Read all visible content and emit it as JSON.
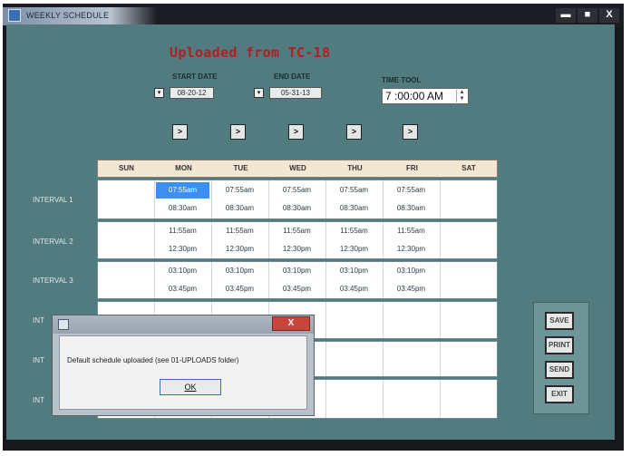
{
  "window": {
    "title": "WEEKLY SCHEDULE",
    "controls": {
      "minimize": "▬",
      "maximize": "■",
      "close": "X"
    }
  },
  "header": {
    "headline": "Uploaded from TC-18",
    "start_date_label": "START DATE",
    "start_date_value": "08-20-12",
    "end_date_label": "END DATE",
    "end_date_value": "05-31-13",
    "time_label": "TIME TOOL",
    "time_value": "7 :00:00 AM",
    "dropdown_glyph": "▾",
    "nav_glyph": ">"
  },
  "grid": {
    "days": [
      "SUN",
      "MON",
      "TUE",
      "WED",
      "THU",
      "FRI",
      "SAT"
    ],
    "interval_labels": [
      "INTERVAL 1",
      "INTERVAL 2",
      "INTERVAL 3"
    ],
    "hidden_row_label": "INT",
    "intervals": [
      {
        "start": [
          "",
          "07:55am",
          "07:55am",
          "07:55am",
          "07:55am",
          "07:55am",
          ""
        ],
        "end": [
          "",
          "08:30am",
          "08:30am",
          "08:30am",
          "08:30am",
          "08:30am",
          ""
        ]
      },
      {
        "start": [
          "",
          "11:55am",
          "11:55am",
          "11:55am",
          "11:55am",
          "11:55am",
          ""
        ],
        "end": [
          "",
          "12:30pm",
          "12:30pm",
          "12:30pm",
          "12:30pm",
          "12:30pm",
          ""
        ]
      },
      {
        "start": [
          "",
          "03:10pm",
          "03:10pm",
          "03:10pm",
          "03:10pm",
          "03:10pm",
          ""
        ],
        "end": [
          "",
          "03:45pm",
          "03:45pm",
          "03:45pm",
          "03:45pm",
          "03:45pm",
          ""
        ]
      }
    ]
  },
  "side_buttons": {
    "save": "SAVE",
    "print": "PRINT",
    "send": "SEND",
    "exit": "EXIT"
  },
  "dialog": {
    "message": "Default schedule uploaded (see 01-UPLOADS folder)",
    "ok_label": "OK",
    "close_label": "X"
  },
  "colors": {
    "background": "#517b7e",
    "selection": "#3b8ff0",
    "headline": "#b21f23"
  }
}
